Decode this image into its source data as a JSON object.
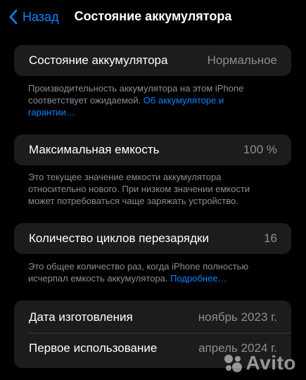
{
  "nav": {
    "back_label": "Назад",
    "title": "Состояние аккумулятора"
  },
  "health": {
    "label": "Состояние аккумулятора",
    "value": "Нормальное",
    "footnote_text": "Производительность аккумулятора на этом iPhone соответствует ожидаемой. ",
    "footnote_link": "Об аккумуляторе и гарантии…"
  },
  "capacity": {
    "label": "Максимальная емкость",
    "value": "100 %",
    "footnote_text": "Это текущее значение емкости аккумулятора относительно нового. При низком значении емкости может потребоваться чаще заряжать устройство."
  },
  "cycles": {
    "label": "Количество циклов перезарядки",
    "value": "16",
    "footnote_text": "Это общее количество раз, когда iPhone полностью исчерпал емкость аккумулятора. ",
    "footnote_link": "Подробнее…"
  },
  "dates": {
    "manufacture_label": "Дата изготовления",
    "manufacture_value": "ноябрь 2023 г.",
    "first_use_label": "Первое использование",
    "first_use_value": "апрель 2024 г."
  },
  "watermark": {
    "text": "Avito"
  },
  "colors": {
    "accent": "#0a84ff",
    "background": "#000000",
    "card": "#1c1c1e",
    "secondary_text": "#8e8e93"
  }
}
